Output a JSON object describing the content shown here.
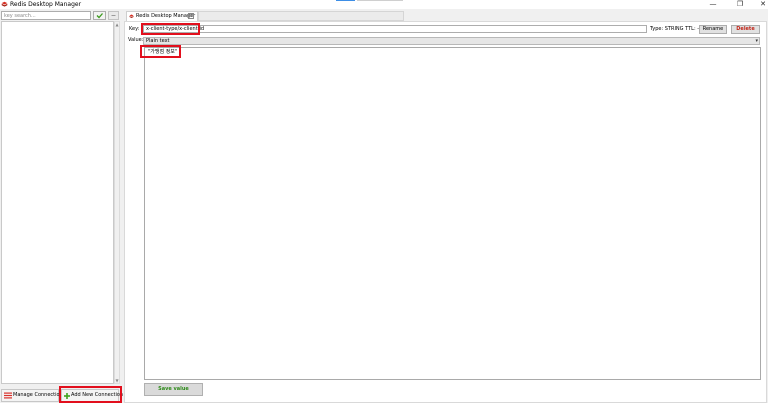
{
  "window": {
    "title": "Redis Desktop Manager",
    "minimize_glyph": "—",
    "maximize_glyph": "❐",
    "close_glyph": "✕"
  },
  "sidebar": {
    "search_placeholder": "key search...",
    "search_ok_icon": "check-icon",
    "manage_connections_label": "Manage Connections",
    "add_connection_label": "Add New Connection"
  },
  "tab": {
    "label": "Redis Desktop Manager",
    "close_glyph": "×"
  },
  "editor": {
    "key_label": "Key:",
    "key_value": "x-client-type/x-client-id",
    "type_ttl": "Type: STRING  TTL: -",
    "rename_label": "Rename",
    "delete_label": "Delete",
    "value_label": "Value:",
    "format_selected": "Plain text",
    "value_text": "\"가맹점 정보\"",
    "save_label": "Save value"
  },
  "colors": {
    "highlight": "#e20f1d",
    "save_text": "#2e8a1a",
    "delete_text": "#c2261a",
    "accent": "#3d8ee6"
  }
}
